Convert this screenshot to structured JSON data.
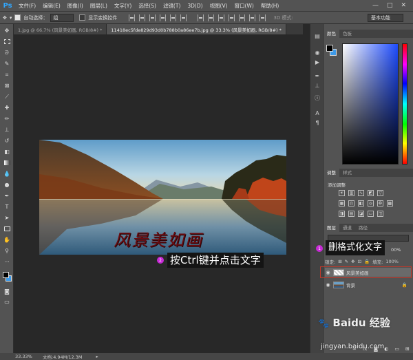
{
  "app": {
    "logo": "Ps",
    "menu": [
      "文件(F)",
      "编辑(E)",
      "图像(I)",
      "图层(L)",
      "文字(Y)",
      "选择(S)",
      "滤镜(T)",
      "3D(D)",
      "视图(V)",
      "窗口(W)",
      "帮助(H)"
    ],
    "window_controls": [
      "—",
      "□",
      "✕"
    ]
  },
  "options_bar": {
    "auto_select_label": "自动选择：",
    "auto_select_value": "组",
    "transform_controls_label": "显示变换控件",
    "mode_3d_label": "3D 模式:",
    "workspace": "基本功能"
  },
  "tabs": [
    {
      "label": "1.jpg @ 66.7% (风景美如画, RGB/8#) *",
      "active": false
    },
    {
      "label": "11418ec5fde829d93d0b788b0a86ee7b.jpg @ 33.3% (风景美如画, RGB/8#) *",
      "active": true
    }
  ],
  "canvas": {
    "photo_caption": "风景美如画"
  },
  "status": {
    "zoom": "33.33%",
    "doc_info": "文档:4.94M/12.3M"
  },
  "panels": {
    "color_tabs": [
      "颜色",
      "色板"
    ],
    "adjust_tabs": [
      "调整",
      "样式"
    ],
    "add_adjustment": "添加调整",
    "layers_tabs": [
      "图层",
      "通道",
      "路径"
    ],
    "lock_label": "锁定:",
    "fill_label": "填充:",
    "fill_value": "100%",
    "opacity_value": "00%",
    "layers": [
      {
        "name": "风景美如画",
        "selected": true
      },
      {
        "name": "背景",
        "selected": false
      }
    ],
    "colors": {
      "foreground": "#000000",
      "background": "#3d9ae8"
    }
  },
  "callouts": {
    "step1_marker": "1",
    "step1_text": "删格式化文字",
    "step2_marker": "2",
    "step2_text": "按Ctrl键并点击文字"
  },
  "watermark": {
    "brand": "Baidu 经验",
    "url": "jingyan.baidu.com"
  }
}
